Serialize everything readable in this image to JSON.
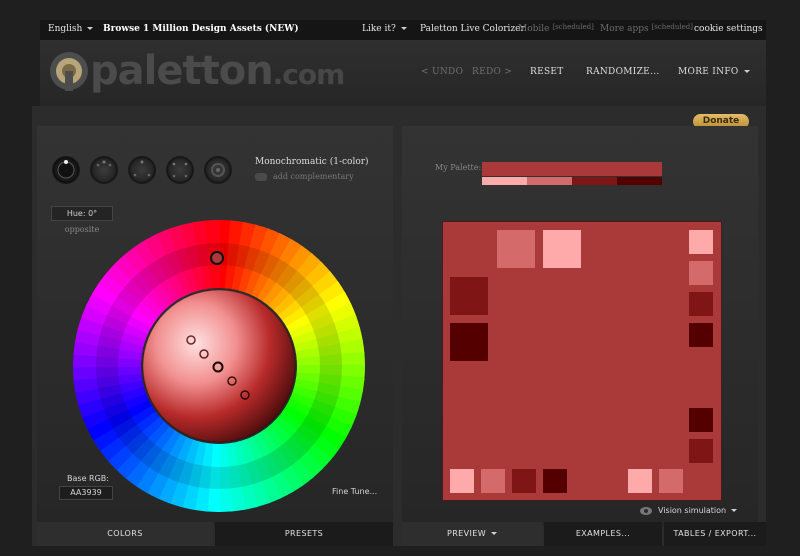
{
  "topbar": {
    "language": "English",
    "promo": "Browse 1 Million Design Assets (NEW)",
    "like_it": "Like it?",
    "live_colorizer": "Paletton Live Colorizer",
    "mobile": "Mobile",
    "mobile_tag": "[scheduled]",
    "more_apps": "More apps",
    "more_apps_tag": "[scheduled]",
    "cookie": "cookie settings"
  },
  "header": {
    "logo_word": "paletton",
    "logo_suffix": ".com",
    "undo": "< UNDO",
    "redo": "REDO >",
    "reset": "RESET",
    "randomize": "RANDOMIZE...",
    "more_info": "MORE INFO"
  },
  "donate": "Donate",
  "colors_panel": {
    "scheme_name": "Monochromatic (1-color)",
    "add_complementary": "add complementary",
    "hue": "Hue: 0°",
    "opposite": "opposite",
    "base_rgb_label": "Base RGB:",
    "base_rgb": "AA3939",
    "fine_tune": "Fine Tune..."
  },
  "preview_panel": {
    "my_palette_label": "My Palette:",
    "palette": [
      "#FFAAAA",
      "#D46A6A",
      "#801515",
      "#550000"
    ],
    "base_color": "#AA3939",
    "vision": "Vision simulation"
  },
  "tabs": {
    "colors": "COLORS",
    "presets": "PRESETS",
    "preview": "PREVIEW",
    "examples": "EXAMPLES...",
    "tables": "TABLES / EXPORT..."
  }
}
